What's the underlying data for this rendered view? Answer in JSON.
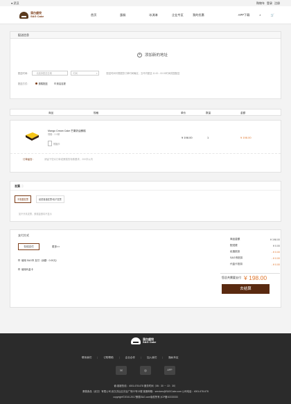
{
  "topbar": {
    "city": "武汉",
    "cart": "购物车",
    "login": "登录",
    "register": "注册"
  },
  "brand": {
    "name_cn": "蛋白盛饺",
    "name_en": "S&G Cake"
  },
  "nav": {
    "items": [
      "首页",
      "蛋糕",
      "冰淇淋",
      "企业专区",
      "我的优惠"
    ],
    "app": "APP下载"
  },
  "delivery": {
    "title": "配送信息",
    "add_address": "添加新的地址",
    "time_label": "配送时间：",
    "date_placeholder": "请选择配送日期",
    "time_placeholder": "时间",
    "hint": "配送时间可根据您订单时间确定，五环内配送 11:00 - 00:00时间范围配送",
    "method_label": "配送方式：",
    "method_delivery": "蛋糕配送",
    "method_pickup": "到店自提"
  },
  "table": {
    "headers": [
      "商品",
      "规格",
      "单价",
      "数量",
      "金额"
    ]
  },
  "product": {
    "name": "Mango Cream Cake 芒果奶油蛋糕",
    "spec": "规格：2.0磅",
    "card": "祝福卡",
    "price": "¥ 198.00",
    "qty": "1",
    "amount": "¥ 198.00",
    "remark_label": "订单留言：",
    "remark_text": "请留下您对订单或蛋糕的特殊要求，200字以内"
  },
  "invoice": {
    "title": "发票",
    "tabs": [
      "不需要发票",
      "纸质普通发票/电子发票"
    ],
    "note": "如不开具发票，蛋糕金额将不显示"
  },
  "payment": {
    "title": "支付方式",
    "selected": "在线支付",
    "more": "更多>>",
    "option_balance": "使用 S&G币 支付（余额：0.00元）",
    "option_card": "使用代金卡"
  },
  "summary": {
    "rows": [
      {
        "label": "商品金额",
        "value": "¥ 198.00"
      },
      {
        "label": "配送费",
        "value": "¥ 0.00"
      },
      {
        "label": "优惠抵扣",
        "value": "- ¥ 0.00"
      },
      {
        "label": "S&G币抵扣",
        "value": "- ¥ 0.00"
      },
      {
        "label": "代金卡抵扣",
        "value": "- ¥ 0.00"
      }
    ],
    "total_label": "您总共需要支付",
    "total": "¥ 198.00",
    "checkout": "去结算"
  },
  "footer": {
    "brand_cn": "蛋白盛饺",
    "brand_en": "S&G Cake",
    "links": [
      "联系我们",
      "订购帮助",
      "企业合作",
      "加入我们",
      "隐私专区"
    ],
    "app": "APP",
    "hotline": "客服热线：4001-678-678 服务时间（08：30 － 22：30）",
    "company": "蛋糕食品（武汉）有限公司 武汉洪山区光谷广场22号13楼 客服邮箱：services@S&GCake.com 公司电话：4001-678-678",
    "copyright": "copyright©2010-2017蛋糕S&G.com版权所有 |ICP备10233333"
  },
  "colors": {
    "brand": "#5a2a10",
    "accent": "#e0762c",
    "footer": "#2b2b2b"
  }
}
